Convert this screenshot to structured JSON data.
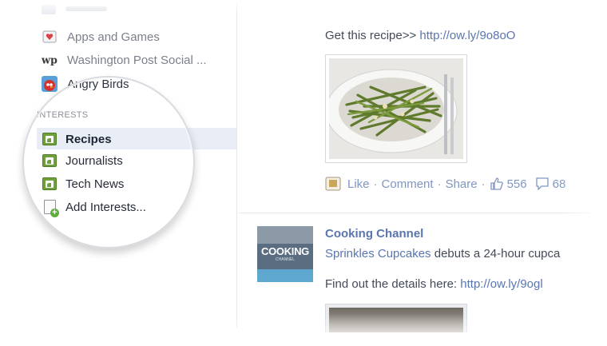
{
  "sidebar": {
    "apps": [
      {
        "label": "Apps and Games",
        "icon": "apps-games-icon"
      },
      {
        "label": "Washington Post Social ...",
        "icon": "washington-post-icon"
      },
      {
        "label": "Angry Birds",
        "icon": "angry-birds-icon"
      }
    ],
    "interests_heading": "INTERESTS",
    "interests": [
      {
        "label": "Recipes",
        "icon": "rss-list-icon",
        "active": true
      },
      {
        "label": "Journalists",
        "icon": "rss-list-icon"
      },
      {
        "label": "Tech News",
        "icon": "rss-list-icon"
      },
      {
        "label": "Add Interests...",
        "icon": "add-interests-icon"
      }
    ]
  },
  "feed": {
    "post1": {
      "text": "Get this recipe>> ",
      "link": "http://ow.ly/9o8oO",
      "photo_alt": "green-beans-dish",
      "actions": {
        "like": "Like",
        "comment": "Comment",
        "share": "Share",
        "sep": "·",
        "likes": "556",
        "comments": "68"
      }
    },
    "post2": {
      "page_name": "Cooking Channel",
      "avatar_text": "COOKING",
      "avatar_sub": "CHANNEL",
      "link_name": "Sprinkles Cupcakes",
      "text_after": " debuts a 24-hour cupca",
      "details_text": "Find out the details here: ",
      "details_link": "http://ow.ly/9ogl"
    }
  },
  "colors": {
    "link": "#5a75b0",
    "highlight": "#e8edf6",
    "rss_green": "#6fa03c"
  }
}
